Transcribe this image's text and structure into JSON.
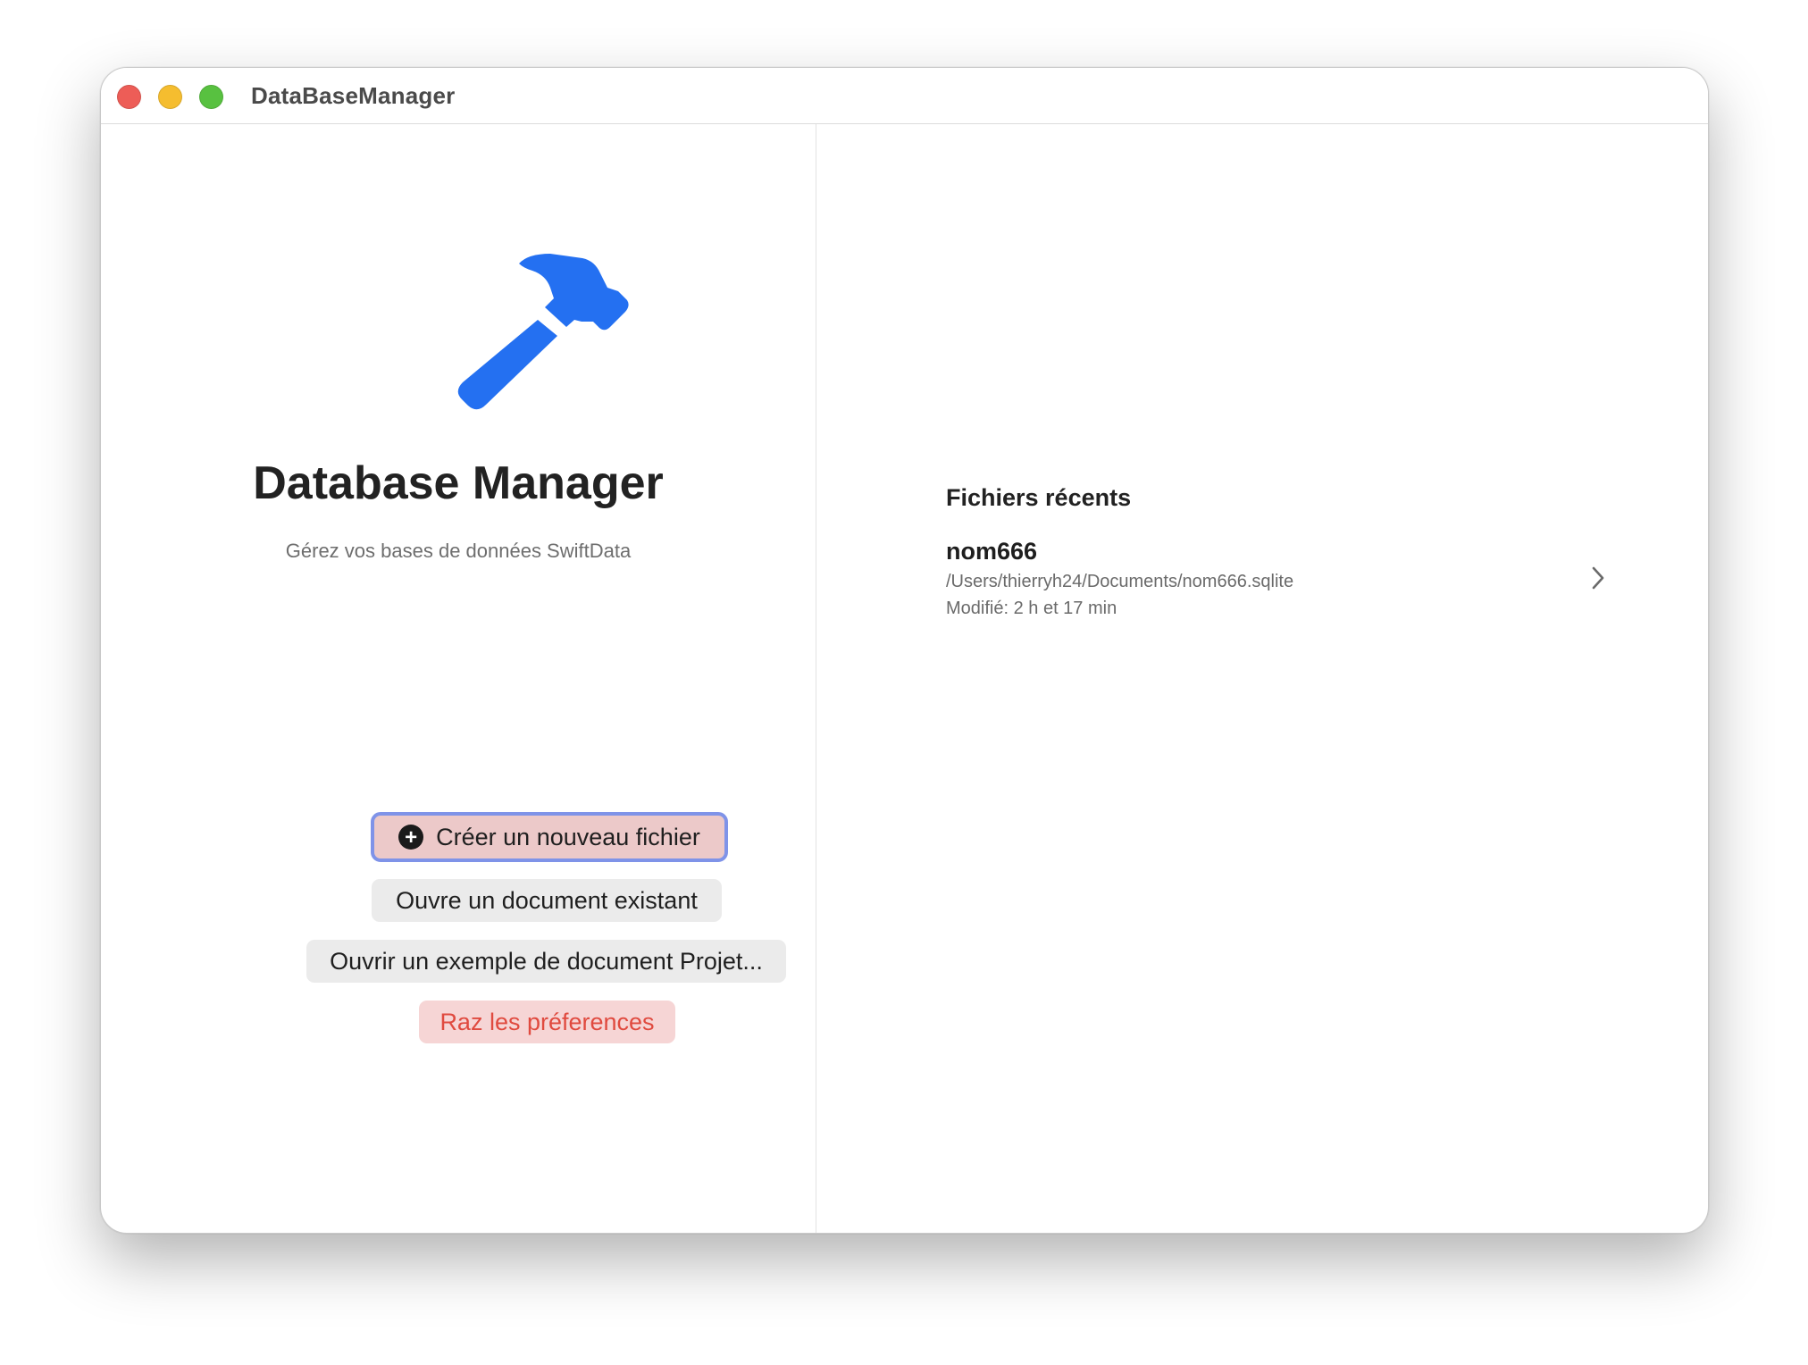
{
  "window": {
    "title": "DataBaseManager"
  },
  "welcome": {
    "icon": "hammer-icon",
    "title": "Database Manager",
    "subtitle": "Gérez vos bases de données SwiftData"
  },
  "actions": {
    "create_label": "Créer un nouveau fichier",
    "open_label": "Ouvre un document existant",
    "example_label": "Ouvrir un exemple de document Projet...",
    "reset_label": "Raz les préferences"
  },
  "recent": {
    "heading": "Fichiers récents",
    "items": [
      {
        "name": "nom666",
        "path": "/Users/thierryh24/Documents/nom666.sqlite",
        "modified": "Modifié: 2 h et 17 min"
      }
    ]
  },
  "colors": {
    "accent": "#2470f1",
    "destructive": "#e04a3f",
    "focus_ring": "#7f93e8"
  }
}
